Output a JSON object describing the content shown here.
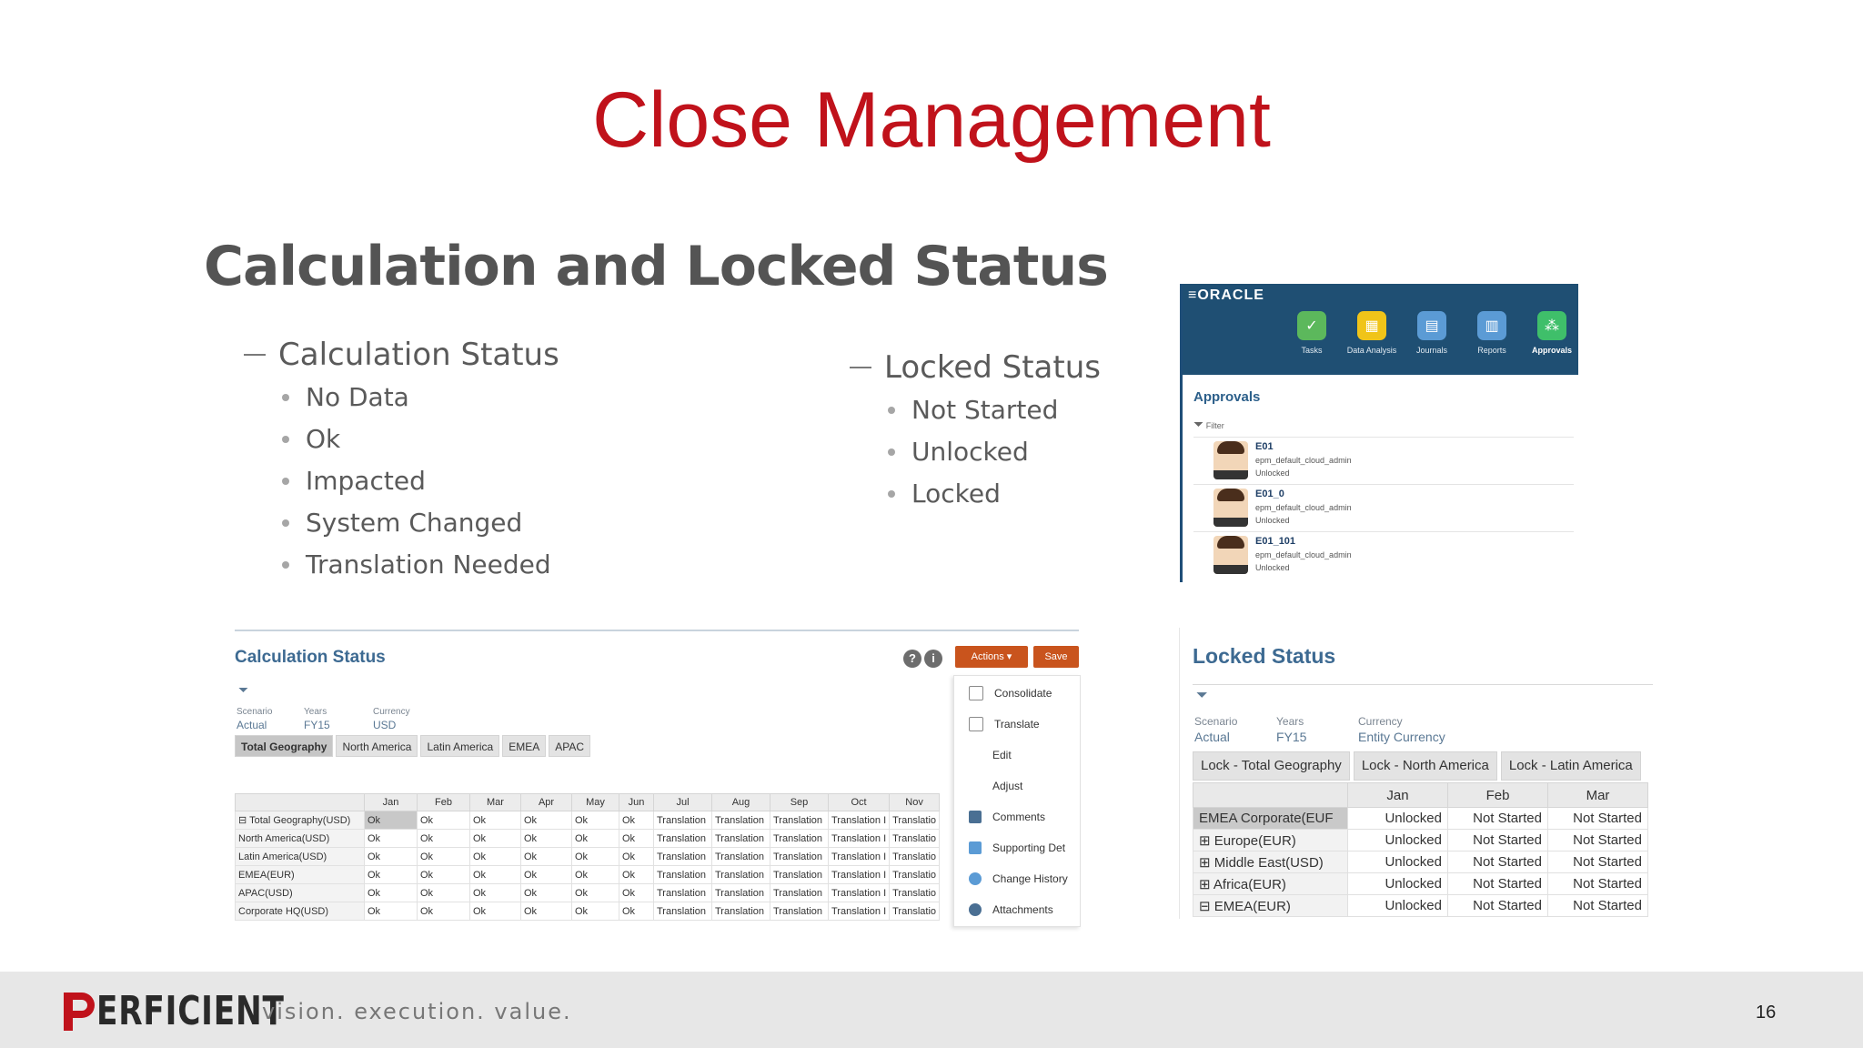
{
  "slide": {
    "title": "Close Management",
    "section_heading": "Calculation and Locked Status",
    "page_number": "16"
  },
  "calc_bullets": {
    "heading": "Calculation Status",
    "items": [
      "No Data",
      "Ok",
      "Impacted",
      "System Changed",
      "Translation Needed"
    ]
  },
  "lock_bullets": {
    "heading": "Locked Status",
    "items": [
      "Not Started",
      "Unlocked",
      "Locked"
    ]
  },
  "oracle_panel": {
    "brand": "≡ORACLE",
    "apps": [
      {
        "label": "Tasks",
        "color": "#5cb85c",
        "icon": "tasks-icon"
      },
      {
        "label": "Data Analysis",
        "color": "#f0c419",
        "icon": "data-analysis-icon"
      },
      {
        "label": "Journals",
        "color": "#5b9bd5",
        "icon": "journals-icon"
      },
      {
        "label": "Reports",
        "color": "#5b9bd5",
        "icon": "reports-icon"
      },
      {
        "label": "Approvals",
        "color": "#3fbf6a",
        "icon": "approvals-icon"
      }
    ],
    "approvals_title": "Approvals",
    "filter_label": "Filter",
    "rows": [
      {
        "id": "E01",
        "user": "epm_default_cloud_admin",
        "state": "Unlocked"
      },
      {
        "id": "E01_0",
        "user": "epm_default_cloud_admin",
        "state": "Unlocked"
      },
      {
        "id": "E01_101",
        "user": "epm_default_cloud_admin",
        "state": "Unlocked"
      }
    ]
  },
  "calc_form": {
    "title": "Calculation Status",
    "actions_label": "Actions ▾",
    "save_label": "Save",
    "pov": [
      {
        "label": "Scenario",
        "value": "Actual"
      },
      {
        "label": "Years",
        "value": "FY15"
      },
      {
        "label": "Currency",
        "value": "USD"
      }
    ],
    "tabs": [
      "Total Geography",
      "North America",
      "Latin America",
      "EMEA",
      "APAC"
    ],
    "columns": [
      "Jan",
      "Feb",
      "Mar",
      "Apr",
      "May",
      "Jun",
      "Jul",
      "Aug",
      "Sep",
      "Oct",
      "Nov"
    ],
    "rows": [
      {
        "label": "⊟ Total Geography(USD)",
        "cells": [
          "Ok",
          "Ok",
          "Ok",
          "Ok",
          "Ok",
          "Ok",
          "Translation",
          "Translation",
          "Translation",
          "Translation I",
          "Translatio"
        ]
      },
      {
        "label": "North America(USD)",
        "cells": [
          "Ok",
          "Ok",
          "Ok",
          "Ok",
          "Ok",
          "Ok",
          "Translation",
          "Translation",
          "Translation",
          "Translation I",
          "Translatio"
        ]
      },
      {
        "label": "Latin America(USD)",
        "cells": [
          "Ok",
          "Ok",
          "Ok",
          "Ok",
          "Ok",
          "Ok",
          "Translation",
          "Translation",
          "Translation",
          "Translation I",
          "Translatio"
        ]
      },
      {
        "label": "EMEA(EUR)",
        "cells": [
          "Ok",
          "Ok",
          "Ok",
          "Ok",
          "Ok",
          "Ok",
          "Translation",
          "Translation",
          "Translation",
          "Translation I",
          "Translatio"
        ]
      },
      {
        "label": "APAC(USD)",
        "cells": [
          "Ok",
          "Ok",
          "Ok",
          "Ok",
          "Ok",
          "Ok",
          "Translation",
          "Translation",
          "Translation",
          "Translation I",
          "Translatio"
        ]
      },
      {
        "label": "Corporate HQ(USD)",
        "cells": [
          "Ok",
          "Ok",
          "Ok",
          "Ok",
          "Ok",
          "Ok",
          "Translation",
          "Translation",
          "Translation",
          "Translation I",
          "Translatio"
        ]
      }
    ],
    "menu": [
      {
        "label": "Consolidate",
        "color": "#8a8a8a"
      },
      {
        "label": "Translate",
        "color": "#8a8a8a"
      },
      {
        "label": "Edit",
        "color": ""
      },
      {
        "label": "Adjust",
        "color": ""
      },
      {
        "label": "Comments",
        "color": "#4a6f93"
      },
      {
        "label": "Supporting Det",
        "color": "#5b9bd5"
      },
      {
        "label": "Change History",
        "color": "#5b9bd5"
      },
      {
        "label": "Attachments",
        "color": "#4a6f93"
      }
    ]
  },
  "lock_form": {
    "title": "Locked Status",
    "pov": [
      {
        "label": "Scenario",
        "value": "Actual"
      },
      {
        "label": "Years",
        "value": "FY15"
      },
      {
        "label": "Currency",
        "value": "Entity Currency"
      }
    ],
    "tabs": [
      "Lock - Total Geography",
      "Lock - North America",
      "Lock - Latin America"
    ],
    "columns": [
      "Jan",
      "Feb",
      "Mar"
    ],
    "rows": [
      {
        "label": "EMEA Corporate(EUF",
        "cells": [
          "Unlocked",
          "Not Started",
          "Not Started"
        ]
      },
      {
        "label": "⊞ Europe(EUR)",
        "cells": [
          "Unlocked",
          "Not Started",
          "Not Started"
        ]
      },
      {
        "label": "⊞ Middle East(USD)",
        "cells": [
          "Unlocked",
          "Not Started",
          "Not Started"
        ]
      },
      {
        "label": "⊞ Africa(EUR)",
        "cells": [
          "Unlocked",
          "Not Started",
          "Not Started"
        ]
      },
      {
        "label": "⊟ EMEA(EUR)",
        "cells": [
          "Unlocked",
          "Not Started",
          "Not Started"
        ]
      }
    ]
  },
  "footer": {
    "logo_text": "ERFICIENT",
    "tagline": "vision.  execution.  value."
  }
}
